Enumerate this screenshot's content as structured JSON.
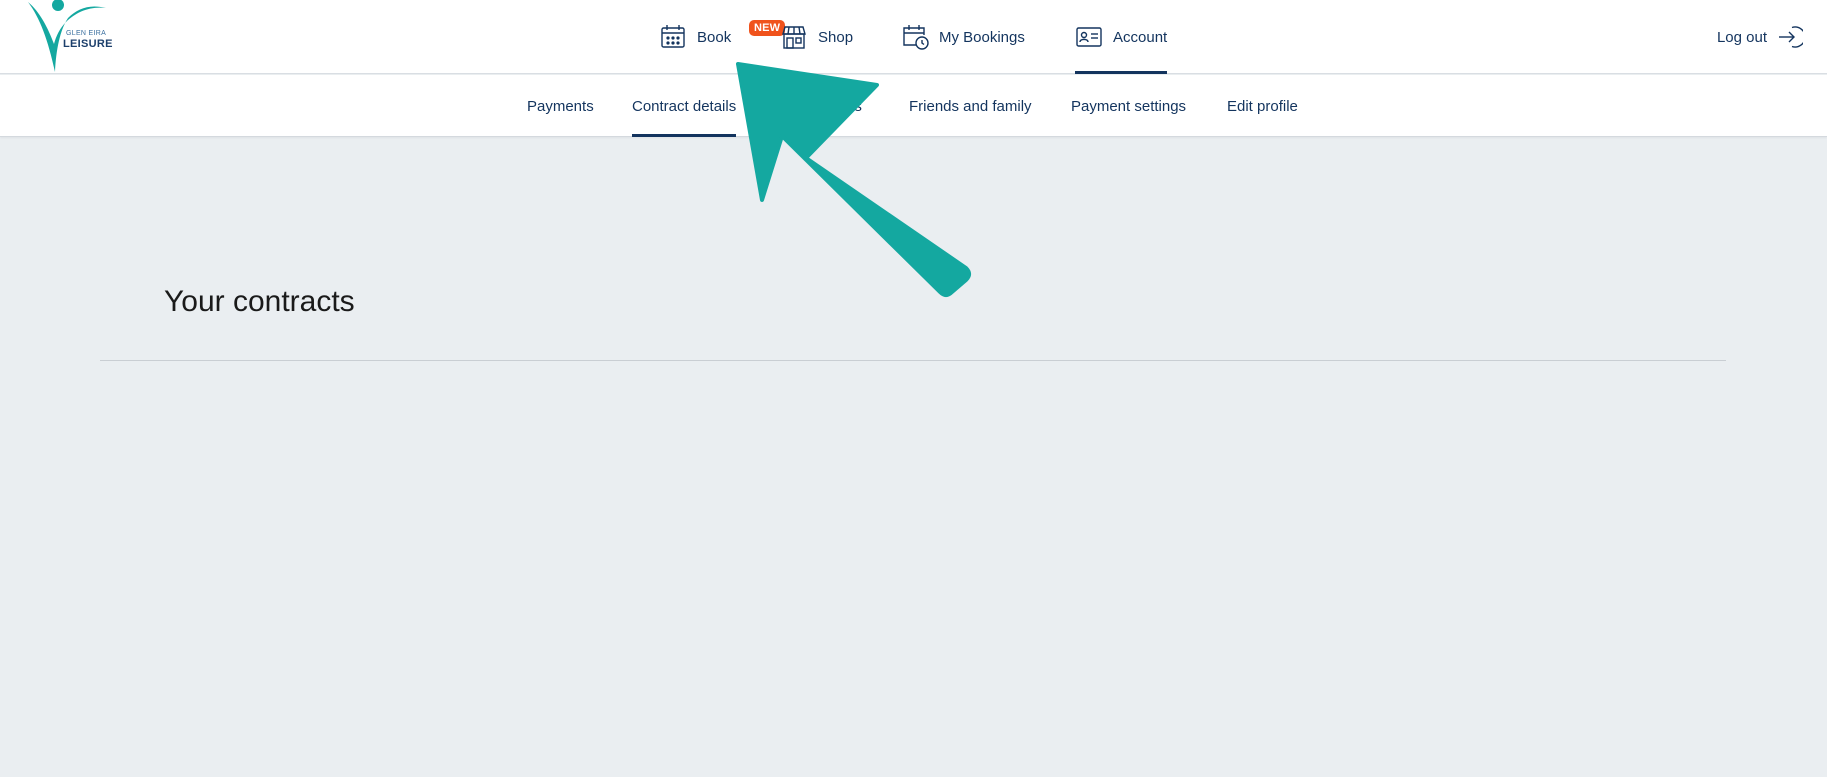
{
  "brand": {
    "line1": "GLEN EIRA",
    "line2": "LEISURE",
    "color": "#14a8a0"
  },
  "nav": {
    "book": "Book",
    "new_badge": "NEW",
    "shop": "Shop",
    "my_bookings": "My Bookings",
    "account": "Account",
    "logout": "Log out"
  },
  "subnav": {
    "payments": "Payments",
    "contract_details": "Contract details",
    "partial_tab": "es",
    "friends_family": "Friends and family",
    "payment_settings": "Payment settings",
    "edit_profile": "Edit profile"
  },
  "main": {
    "heading": "Your contracts"
  },
  "colors": {
    "navy": "#13345e",
    "badge": "#f0531c",
    "arrow": "#14a8a0",
    "background": "#eaeef1"
  }
}
